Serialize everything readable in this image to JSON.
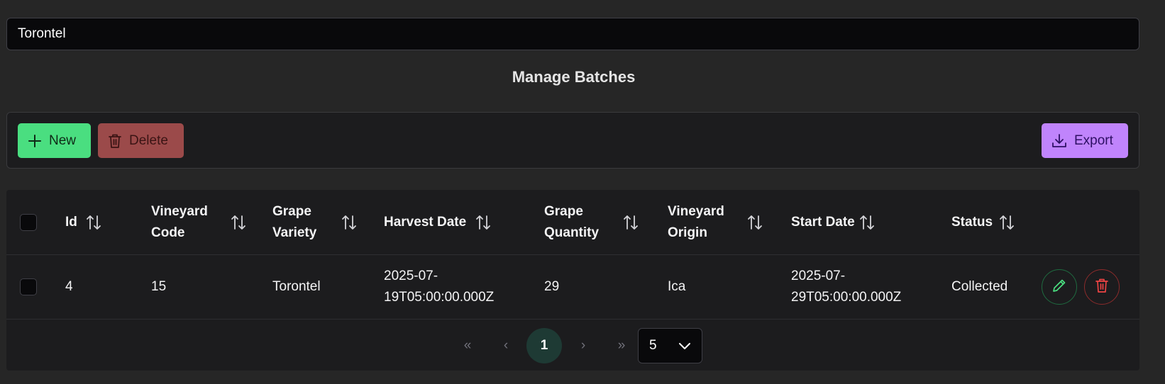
{
  "search": {
    "value": "Torontel"
  },
  "page": {
    "title": "Manage Batches"
  },
  "toolbar": {
    "new_label": "New",
    "delete_label": "Delete",
    "export_label": "Export",
    "colors": {
      "new": "#4ade80",
      "delete": "#9b4a4a",
      "export": "#c084fc"
    }
  },
  "table": {
    "columns": {
      "id": "Id",
      "vineyard_code": [
        "Vineyard",
        "Code"
      ],
      "grape_variety": [
        "Grape",
        "Variety"
      ],
      "harvest_date": "Harvest Date",
      "grape_quantity": [
        "Grape",
        "Quantity"
      ],
      "vineyard_origin": [
        "Vineyard",
        "Origin"
      ],
      "start_date": "Start Date",
      "status": "Status"
    },
    "rows": [
      {
        "id": "4",
        "vineyard_code": "15",
        "grape_variety": "Torontel",
        "harvest_date": [
          "2025-07-",
          "19T05:00:00.000Z"
        ],
        "grape_quantity": "29",
        "vineyard_origin": "Ica",
        "start_date": [
          "2025-07-",
          "29T05:00:00.000Z"
        ],
        "status": "Collected"
      }
    ]
  },
  "pagination": {
    "first": "«",
    "prev": "‹",
    "current_page": "1",
    "next": "›",
    "last": "»",
    "rows_per_page": "5"
  }
}
